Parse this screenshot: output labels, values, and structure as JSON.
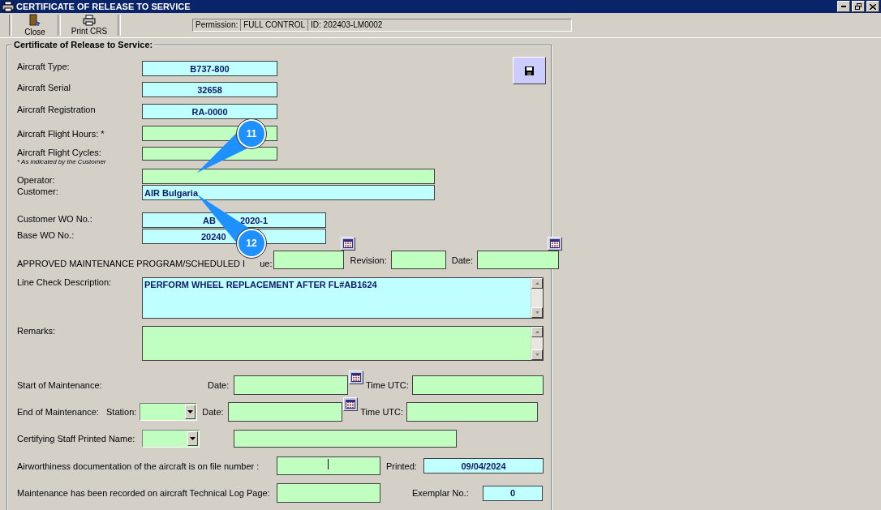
{
  "window": {
    "title": "CERTIFICATE OF RELEASE TO SERVICE"
  },
  "toolbar": {
    "buttons": [
      {
        "label": "Close",
        "kind": "close"
      },
      {
        "label": "Print CRS",
        "kind": "print"
      }
    ],
    "permission_label": "Permission:",
    "permission": "FULL CONTROL",
    "id": "ID: 202403-LM0002"
  },
  "form": {
    "title": "Certificate of Release to Service:",
    "aircraft_type": {
      "label": "Aircraft Type:",
      "value": "B737-800"
    },
    "aircraft_serial": {
      "label": "Aircraft Serial",
      "value": "32658"
    },
    "aircraft_registration": {
      "label": "Aircraft Registration",
      "value": "RA-0000"
    },
    "flight_hours": {
      "label": "Aircraft Flight Hours: *"
    },
    "flight_cycles": {
      "label": "Aircraft Flight Cycles:",
      "note": "* As indicated by the Customer"
    },
    "operator": {
      "label": "Operator:"
    },
    "customer": {
      "label": "Customer:",
      "value": "AIR Bulgaria"
    },
    "customer_wo": {
      "label": "Customer WO No.:",
      "value_parts": [
        "AB",
        "2020-1"
      ]
    },
    "base_wo": {
      "label": "Base WO No.:",
      "value_parts": [
        "20240"
      ]
    },
    "program": {
      "label_parts": [
        "APPROVED MAINTENANCE PROGRAM/SCHEDULED I",
        "ue:"
      ],
      "revision_label": "Revision:",
      "date_label": "Date:"
    },
    "line_check": {
      "label": "Line Check Description:",
      "value": "PERFORM WHEEL REPLACEMENT AFTER FL#AB1624"
    },
    "remarks": {
      "label": "Remarks:"
    },
    "start": {
      "label": "Start of Maintenance:",
      "date_label": "Date:",
      "time_label": "Time UTC:"
    },
    "end": {
      "label": "End of Maintenance:",
      "station_label": "Station:",
      "date_label": "Date:",
      "time_label": "Time UTC:"
    },
    "certifying": {
      "label": "Certifying Staff Printed Name:"
    },
    "airworthiness": {
      "label": "Airworthiness documentation of the aircraft is on file number :",
      "printed_label": "Printed:",
      "printed_value": "09/04/2024"
    },
    "tech_log": {
      "label": "Maintenance has been recorded on aircraft Technical Log Page:",
      "exemplar_label": "Exemplar No.:",
      "exemplar_value": "0"
    }
  },
  "callouts": [
    {
      "number": "11"
    },
    {
      "number": "12"
    }
  ]
}
